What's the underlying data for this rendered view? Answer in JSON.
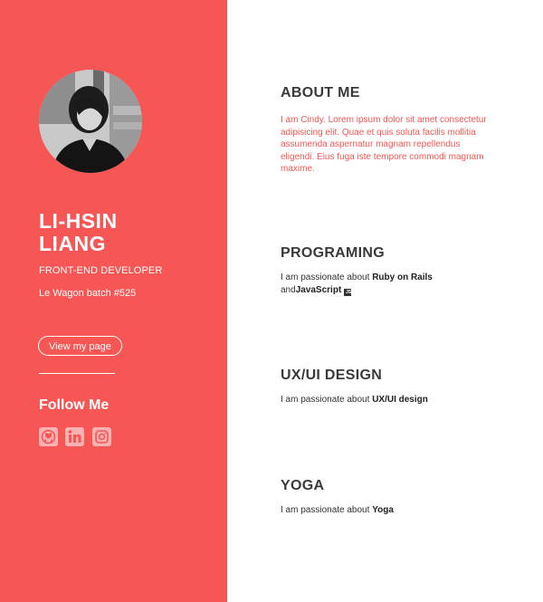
{
  "profile": {
    "first_name": "LI-HSIN",
    "last_name": "LIANG",
    "role": "FRONT-END DEVELOPER",
    "batch": "Le Wagon batch #525",
    "view_button": "View my page",
    "follow_title": "Follow Me"
  },
  "social": [
    "github-icon",
    "linkedin-icon",
    "instagram-icon"
  ],
  "colors": {
    "accent": "#f65654",
    "heading": "#3a3a3a",
    "body_text": "#333333"
  },
  "sections": {
    "about": {
      "title": "ABOUT ME",
      "text": "I am Cindy. Lorem ipsum dolor sit amet consectetur adipisicing elit. Quae et quis soluta facilis mollitia assumenda aspernatur magnam repellendus eligendi. Eius fuga iste tempore commodi magnam maxime."
    },
    "programming": {
      "title": "PROGRAMING",
      "prefix": "I am passionate about ",
      "skill1": "Ruby on Rails",
      "connector": "and",
      "skill2": "JavaScript"
    },
    "uxui": {
      "title": "UX/UI DESIGN",
      "prefix": "I am passionate about ",
      "skill": "UX/UI design"
    },
    "yoga": {
      "title": "YOGA",
      "prefix": "I am passionate about ",
      "skill": "Yoga"
    }
  }
}
